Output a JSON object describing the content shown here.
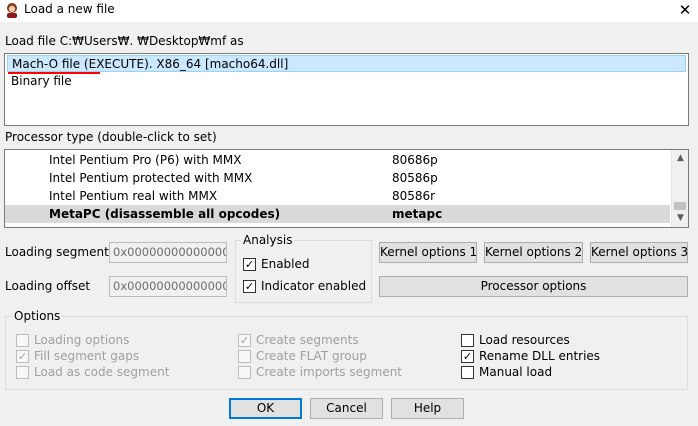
{
  "window": {
    "title": "Load a new file",
    "close_glyph": "✕",
    "app_icon": "ida-app-icon"
  },
  "load_file": {
    "label": "Load file C:₩Users₩.          ₩Desktop₩mf as",
    "items": [
      "Mach-O file (EXECUTE). X86_64 [macho64.dll]",
      "Binary file"
    ],
    "selected_index": 0
  },
  "processor": {
    "label": "Processor type (double-click to set)",
    "rows": [
      {
        "name": "Intel Pentium Pro (P6) with MMX",
        "code": "80686p"
      },
      {
        "name": "Intel Pentium protected with MMX",
        "code": "80586p"
      },
      {
        "name": "Intel Pentium real with MMX",
        "code": "80586r"
      },
      {
        "name": "MetaPC (disassemble all opcodes)",
        "code": "metapc"
      }
    ],
    "selected_index": 3
  },
  "segments": {
    "loading_segment_label": "Loading segment",
    "loading_segment_value": "0x0000000000000000",
    "loading_offset_label": "Loading offset",
    "loading_offset_value": "0x0000000000000000"
  },
  "analysis": {
    "title": "Analysis",
    "enabled_label": "Enabled",
    "enabled_checked": true,
    "indicator_label": "Indicator enabled",
    "indicator_checked": true
  },
  "kernel": {
    "options1": "Kernel options 1",
    "options2": "Kernel options 2",
    "options3": "Kernel options 3",
    "processor_options": "Processor options"
  },
  "options": {
    "title": "Options",
    "loading_options": "Loading options",
    "fill_segment_gaps": "Fill segment gaps",
    "load_as_code_segment": "Load as code segment",
    "create_segments": "Create segments",
    "create_flat_group": "Create FLAT group",
    "create_imports_segment": "Create imports segment",
    "load_resources": "Load resources",
    "rename_dll_entries": "Rename DLL entries",
    "manual_load": "Manual load",
    "check_glyph": "✓"
  },
  "buttons": {
    "ok": "OK",
    "cancel": "Cancel",
    "help": "Help"
  },
  "colors": {
    "selection": "#cce8ff",
    "default_button_border": "#0078d7",
    "annotation_underline": "#ff0000"
  }
}
